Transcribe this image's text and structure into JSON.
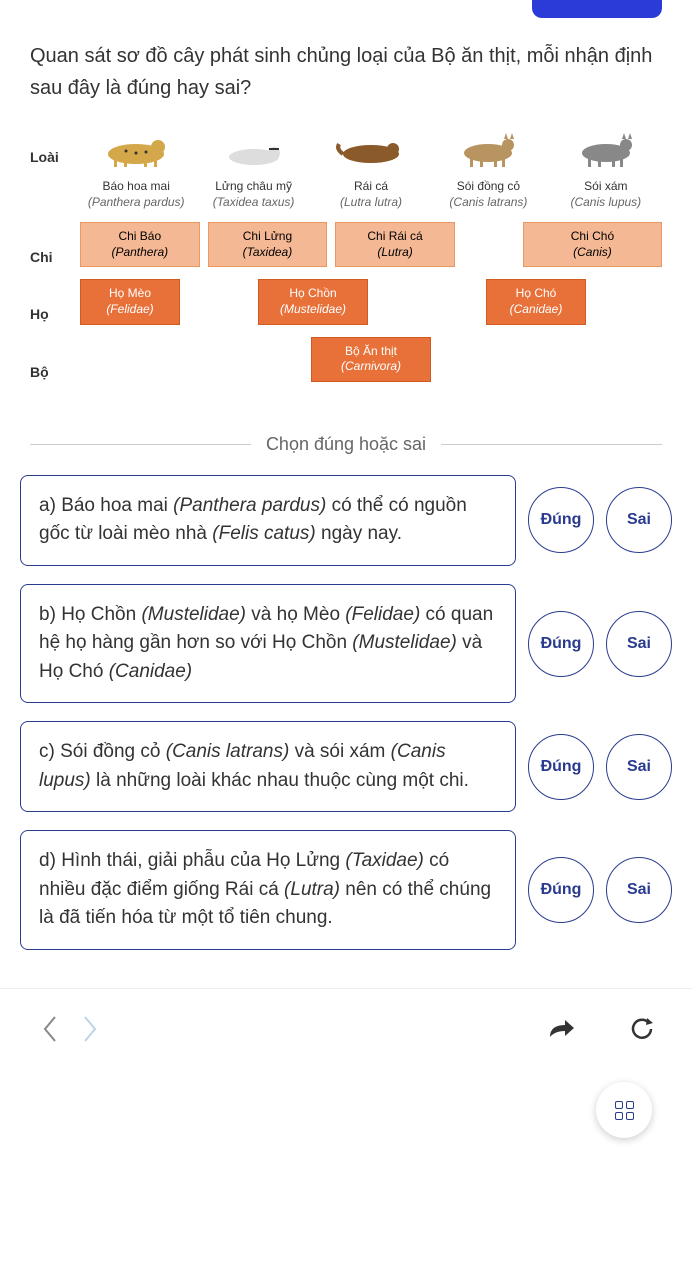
{
  "question": "Quan sát sơ đồ cây phát sinh chủng loại của Bộ ăn thịt, mỗi nhận định sau đây là đúng hay sai?",
  "diagram": {
    "row_labels": {
      "species": "Loài",
      "genus": "Chi",
      "family": "Họ",
      "order": "Bộ"
    },
    "species": [
      {
        "name": "Báo hoa mai",
        "sci": "(Panthera pardus)"
      },
      {
        "name": "Lửng châu mỹ",
        "sci": "(Taxidea taxus)"
      },
      {
        "name": "Rái cá",
        "sci": "(Lutra lutra)"
      },
      {
        "name": "Sói đồng cỏ",
        "sci": "(Canis latrans)"
      },
      {
        "name": "Sói xám",
        "sci": "(Canis lupus)"
      }
    ],
    "genus": [
      {
        "name": "Chi Báo",
        "sci": "(Panthera)"
      },
      {
        "name": "Chi Lửng",
        "sci": "(Taxidea)"
      },
      {
        "name": "Chi Rái cá",
        "sci": "(Lutra)"
      },
      {
        "name": "Chi Chó",
        "sci": "(Canis)"
      }
    ],
    "family": [
      {
        "name": "Họ Mèo",
        "sci": "(Felidae)"
      },
      {
        "name": "Họ Chồn",
        "sci": "(Mustelidae)"
      },
      {
        "name": "Họ Chó",
        "sci": "(Canidae)"
      }
    ],
    "order": {
      "name": "Bộ Ăn thịt",
      "sci": "(Carnivora)"
    }
  },
  "separator_text": "Chọn đúng hoặc sai",
  "btn_true": "Đúng",
  "btn_false": "Sai",
  "answers": [
    {
      "label": "a)",
      "text": "Báo hoa mai <em>(Panthera pardus)</em> có thể có nguồn gốc từ loài mèo nhà <em>(Felis catus)</em> ngày nay."
    },
    {
      "label": "b)",
      "text": "Họ Chồn <em>(Mustelidae)</em> và họ Mèo <em>(Felidae)</em> có quan hệ họ hàng gần hơn so với Họ Chồn <em>(Mustelidae)</em> và Họ Chó <em>(Canidae)</em>"
    },
    {
      "label": "c)",
      "text": "Sói đồng cỏ <em>(Canis latrans)</em> và sói xám <em>(Canis lupus)</em> là những loài khác nhau thuộc cùng một chi."
    },
    {
      "label": "d)",
      "text": "Hình thái, giải phẫu của Họ Lửng <em>(Taxidae)</em> có nhiều đặc điểm giống Rái cá <em>(Lutra)</em> nên có thể chúng là đã tiến hóa từ một tổ tiên chung."
    }
  ]
}
